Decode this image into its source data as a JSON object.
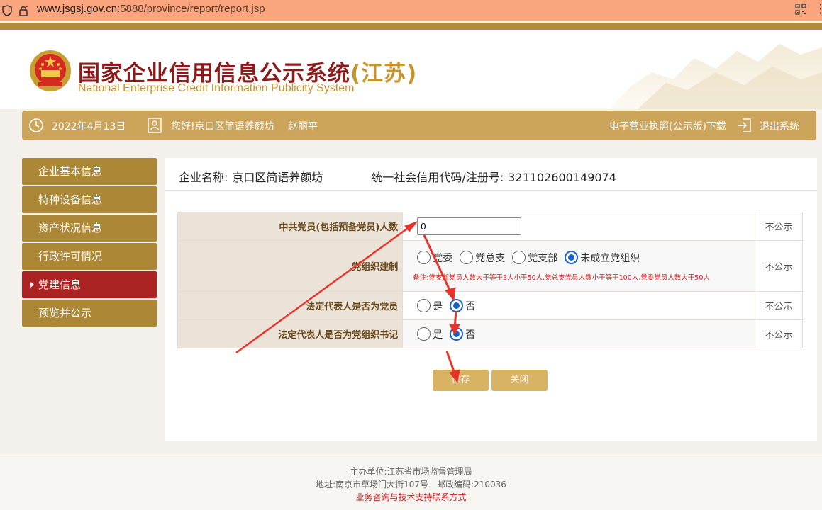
{
  "browser": {
    "url_host": "www.jsgsj.gov.cn",
    "url_rest": ":5888/province/report/report.jsp"
  },
  "header": {
    "title_main": "国家企业信用信息公示系统",
    "title_region": "(江苏)",
    "title_en": "National Enterprise Credit Information Publicity System"
  },
  "userbar": {
    "date": "2022年4月13日",
    "greeting": "您好!京口区简语养颜坊",
    "user_name": "赵丽平",
    "license_download": "电子营业执照(公示版)下载",
    "logout": "退出系统"
  },
  "sidebar": {
    "items": [
      {
        "label": "企业基本信息"
      },
      {
        "label": "特种设备信息"
      },
      {
        "label": "资产状况信息"
      },
      {
        "label": "行政许可情况"
      },
      {
        "label": "党建信息"
      },
      {
        "label": "预览并公示"
      }
    ]
  },
  "company": {
    "name_label": "企业名称:",
    "name_value": "京口区简语养颜坊",
    "code_label": "统一社会信用代码/注册号:",
    "code_value": "321102600149074"
  },
  "form": {
    "rows": [
      {
        "label": "中共党员(包括预备党员)人数",
        "publicity": "不公示"
      },
      {
        "label": "党组织建制",
        "publicity": "不公示"
      },
      {
        "label": "法定代表人是否为党员",
        "publicity": "不公示"
      },
      {
        "label": "法定代表人是否为党组织书记",
        "publicity": "不公示"
      }
    ],
    "member_count_value": "0",
    "org_options": [
      "党委",
      "党总支",
      "党支部",
      "未成立党组织"
    ],
    "org_note": "备注:党支部党员人数大于等于3人小于50人,党总支党员人数小于等于100人,党委党员人数大于50人",
    "yes": "是",
    "no": "否"
  },
  "buttons": {
    "save": "保存",
    "close": "关闭"
  },
  "footer": {
    "sponsor": "主办单位:江苏省市场监督管理局",
    "address": "地址:南京市草场门大街107号　邮政编码:210036",
    "support_link": "业务咨询与技术支持联系方式"
  },
  "colors": {
    "gold": "#cca45a",
    "sidebar_gold": "#ab8736",
    "active_red": "#ab2323",
    "button_gold": "#d9b364",
    "annotation_red": "#e8332b",
    "radio_blue": "#1a63c9"
  }
}
